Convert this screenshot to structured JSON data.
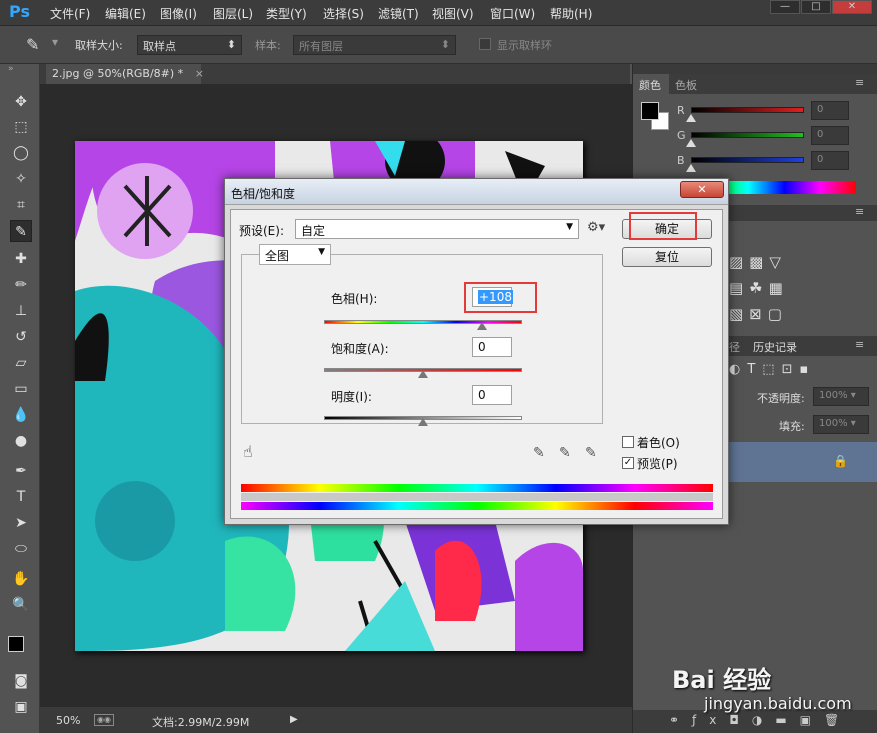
{
  "app": {
    "logo": "Ps"
  },
  "menu": [
    "文件(F)",
    "编辑(E)",
    "图像(I)",
    "图层(L)",
    "类型(Y)",
    "选择(S)",
    "滤镜(T)",
    "视图(V)",
    "窗口(W)",
    "帮助(H)"
  ],
  "window_controls": {
    "minimize": "—",
    "restore": "□",
    "close": "✕"
  },
  "options": {
    "sample_size_label": "取样大小:",
    "sample_size_value": "取样点",
    "sample_label": "样本:",
    "sample_value": "所有图层",
    "show_ring_label": "显示取样环"
  },
  "document": {
    "tab_title": "2.jpg @ 50%(RGB/8#) *",
    "tab_close": "×"
  },
  "status": {
    "zoom": "50%",
    "doc_info": "文档:2.99M/2.99M"
  },
  "panels": {
    "color_tab": "颜色",
    "swatches_tab": "色板",
    "channels": [
      {
        "label": "R",
        "value": "0",
        "color": "#e02020"
      },
      {
        "label": "G",
        "value": "0",
        "color": "#20c020"
      },
      {
        "label": "B",
        "value": "0",
        "color": "#2040e0"
      }
    ],
    "history_tab_partial": "径",
    "history_tab": "历史记录",
    "opacity_label": "不透明度:",
    "opacity_value": "100%",
    "fill_label": "填充:",
    "fill_value": "100%"
  },
  "dialog": {
    "title": "色相/饱和度",
    "close_icon": "✕",
    "preset_label": "预设(E):",
    "preset_value": "自定",
    "range_value": "全图",
    "hue_label": "色相(H):",
    "hue_value": "+108",
    "saturation_label": "饱和度(A):",
    "saturation_value": "0",
    "lightness_label": "明度(I):",
    "lightness_value": "0",
    "ok_button": "确定",
    "reset_button": "复位",
    "colorize_label": "着色(O)",
    "colorize_checked": false,
    "preview_label": "预览(P)",
    "preview_checked": true
  },
  "watermark": {
    "brand": "Bai 经验",
    "url": "jingyan.baidu.com"
  }
}
